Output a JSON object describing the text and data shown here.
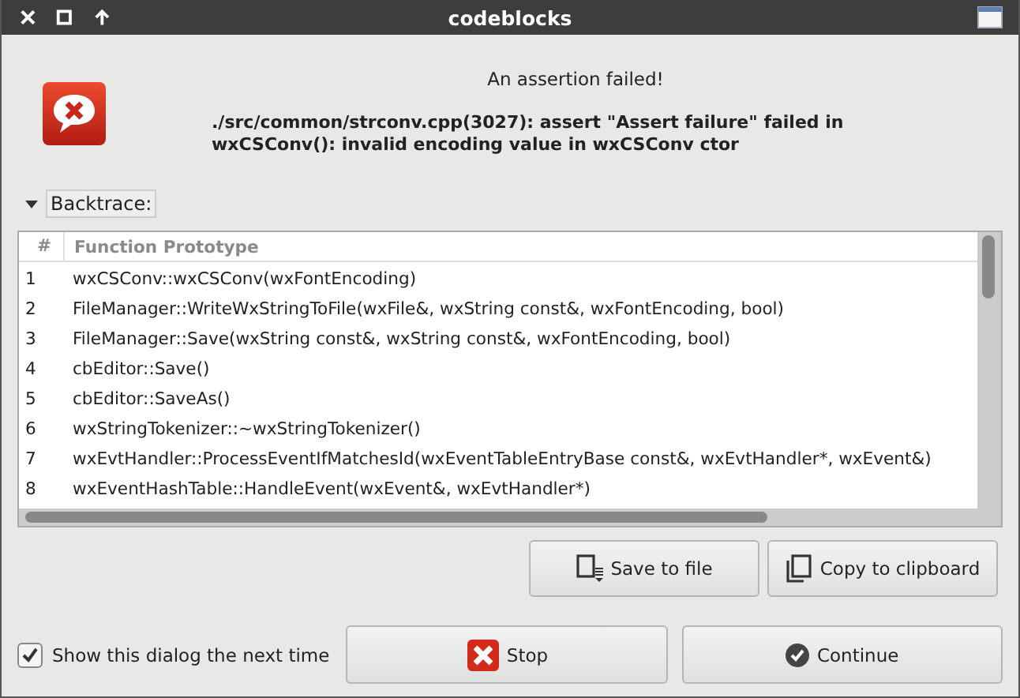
{
  "window": {
    "title": "codeblocks"
  },
  "message": {
    "heading": "An assertion failed!",
    "detail": "./src/common/strconv.cpp(3027): assert \"Assert failure\" failed in wxCSConv(): invalid encoding value in wxCSConv ctor"
  },
  "backtrace": {
    "label": "Backtrace:",
    "expanded": true
  },
  "table": {
    "columns": [
      "#",
      "Function Prototype"
    ],
    "rows": [
      {
        "num": "1",
        "proto": "wxCSConv::wxCSConv(wxFontEncoding)"
      },
      {
        "num": "2",
        "proto": "FileManager::WriteWxStringToFile(wxFile&, wxString const&, wxFontEncoding, bool)"
      },
      {
        "num": "3",
        "proto": "FileManager::Save(wxString const&, wxString const&, wxFontEncoding, bool)"
      },
      {
        "num": "4",
        "proto": "cbEditor::Save()"
      },
      {
        "num": "5",
        "proto": "cbEditor::SaveAs()"
      },
      {
        "num": "6",
        "proto": "wxStringTokenizer::~wxStringTokenizer()"
      },
      {
        "num": "7",
        "proto": "wxEvtHandler::ProcessEventIfMatchesId(wxEventTableEntryBase const&, wxEvtHandler*, wxEvent&)"
      },
      {
        "num": "8",
        "proto": "wxEventHashTable::HandleEvent(wxEvent&, wxEvtHandler*)"
      }
    ]
  },
  "actions": [
    "Save to file",
    "Copy to clipboard"
  ],
  "show_next_time": {
    "label": "Show this dialog the next time",
    "checked": true
  },
  "buttons": [
    {
      "kind": "stop",
      "label": "Stop"
    },
    {
      "kind": "continue",
      "label": "Continue"
    }
  ]
}
